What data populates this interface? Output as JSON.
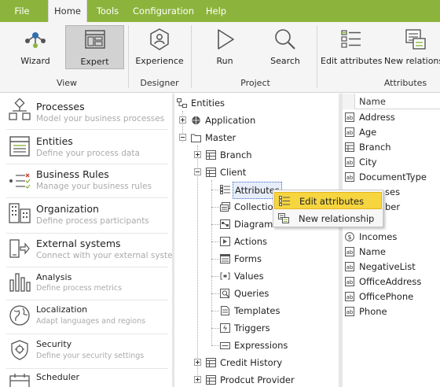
{
  "menu": {
    "items": [
      "File",
      "Home",
      "Tools",
      "Configuration",
      "Help"
    ],
    "active": "Home"
  },
  "ribbon": {
    "buttons": {
      "wizard": "Wizard",
      "expert": "Expert",
      "experience": "Experience",
      "run": "Run",
      "search": "Search",
      "edit_attributes": "Edit attributes",
      "new_relationship": "New relationship"
    },
    "groups": {
      "view": "View",
      "designer": "Designer",
      "project": "Project",
      "attributes": "Attributes"
    }
  },
  "nav": {
    "processes": {
      "title": "Processes",
      "subtitle": "Model your business processes"
    },
    "entities": {
      "title": "Entities",
      "subtitle": "Define your process data"
    },
    "business_rules": {
      "title": "Business Rules",
      "subtitle": "Manage your business rules"
    },
    "organization": {
      "title": "Organization",
      "subtitle": "Define process participants"
    },
    "external_systems": {
      "title": "External systems",
      "subtitle": "Connect with your external systems"
    },
    "analysis": {
      "title": "Analysis",
      "subtitle": "Define process metrics"
    },
    "localization": {
      "title": "Localization",
      "subtitle": "Adapt languages and regions"
    },
    "security": {
      "title": "Security",
      "subtitle": "Define your security settings"
    },
    "scheduler": {
      "title": "Scheduler",
      "subtitle": ""
    }
  },
  "tree": {
    "root": "Entities",
    "application": "Application",
    "master": "Master",
    "branch": "Branch",
    "client": "Client",
    "children": {
      "attributes": "Attributes",
      "collections": "Collection",
      "diagrams": "Diagrams",
      "actions": "Actions",
      "forms": "Forms",
      "values": "Values",
      "queries": "Queries",
      "templates": "Templates",
      "triggers": "Triggers",
      "expressions": "Expressions"
    },
    "credit_history": "Credit History",
    "product_provider": "Prodcut Provider"
  },
  "list": {
    "header": "Name",
    "rows": [
      "Address",
      "Age",
      "Branch",
      "City",
      "DocumentType",
      "",
      "",
      "",
      "Incomes",
      "Name",
      "NegativeList",
      "OfficeAddress",
      "OfficePhone",
      "Phone"
    ],
    "partial": {
      "r5": "ses",
      "r6": "ber"
    }
  },
  "context_menu": {
    "edit_attributes": "Edit attributes",
    "new_relationship": "New relationship"
  },
  "colors": {
    "brand": "#8cb43c",
    "highlight": "#f6d53f",
    "selection": "#3a6ec8"
  }
}
